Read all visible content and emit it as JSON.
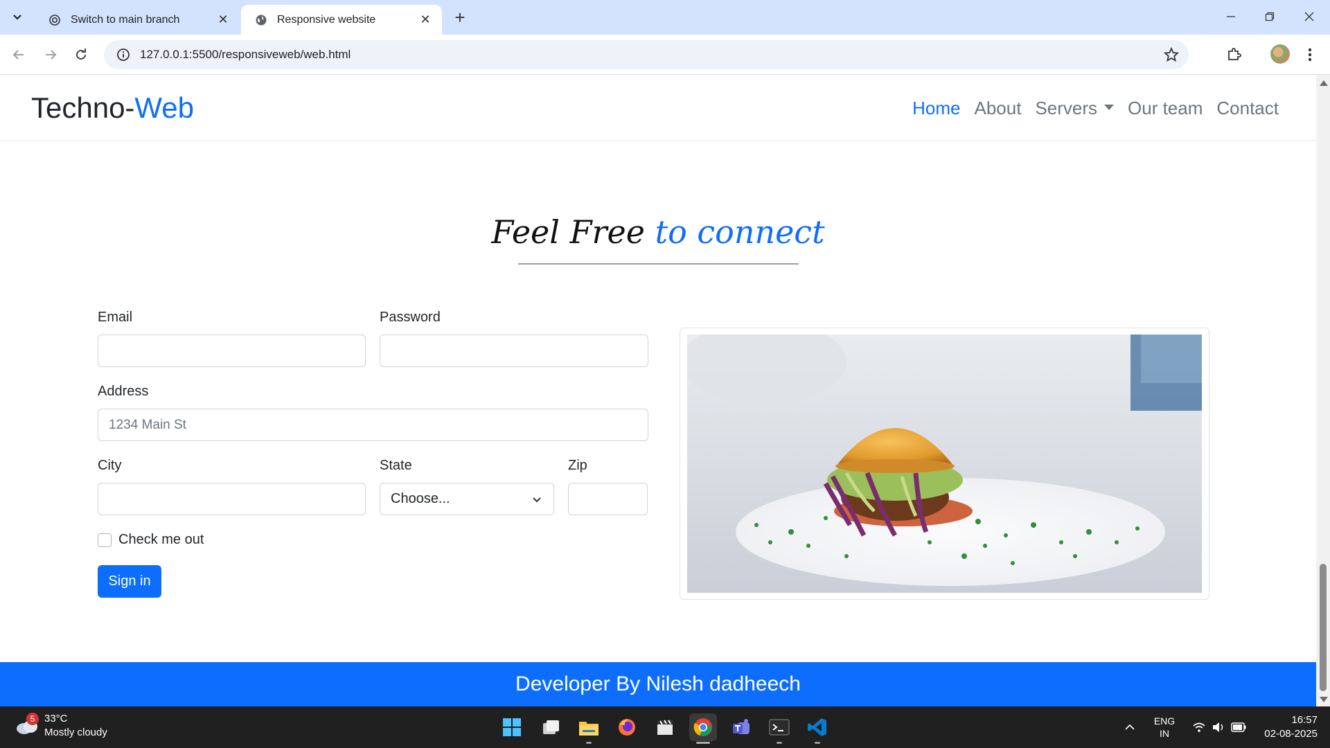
{
  "browser": {
    "tabs": [
      {
        "title": "Switch to main branch",
        "active": false
      },
      {
        "title": "Responsive website",
        "active": true
      }
    ],
    "url": "127.0.0.1:5500/responsiveweb/web.html"
  },
  "site": {
    "brand": {
      "part1": "Techno-",
      "part2": "Web"
    },
    "nav": [
      {
        "label": "Home",
        "active": true
      },
      {
        "label": "About"
      },
      {
        "label": "Servers",
        "dropdown": true
      },
      {
        "label": "Our team"
      },
      {
        "label": "Contact"
      }
    ],
    "heading": {
      "part1": "Feel Free ",
      "part2": "to connect"
    },
    "form": {
      "email_label": "Email",
      "password_label": "Password",
      "address_label": "Address",
      "address_placeholder": "1234 Main St",
      "city_label": "City",
      "state_label": "State",
      "state_selected": "Choose...",
      "zip_label": "Zip",
      "check_label": "Check me out",
      "submit_label": "Sign in"
    },
    "footer": "Developer By Nilesh dadheech"
  },
  "taskbar": {
    "weather": {
      "temp": "33°C",
      "condition": "Mostly cloudy",
      "badge": "5"
    },
    "lang": {
      "line1": "ENG",
      "line2": "IN"
    },
    "time": "16:57",
    "date": "02-08-2025"
  },
  "colors": {
    "accent": "#0d6efd",
    "tab_strip": "#d3e3fd",
    "taskbar": "#202020"
  }
}
